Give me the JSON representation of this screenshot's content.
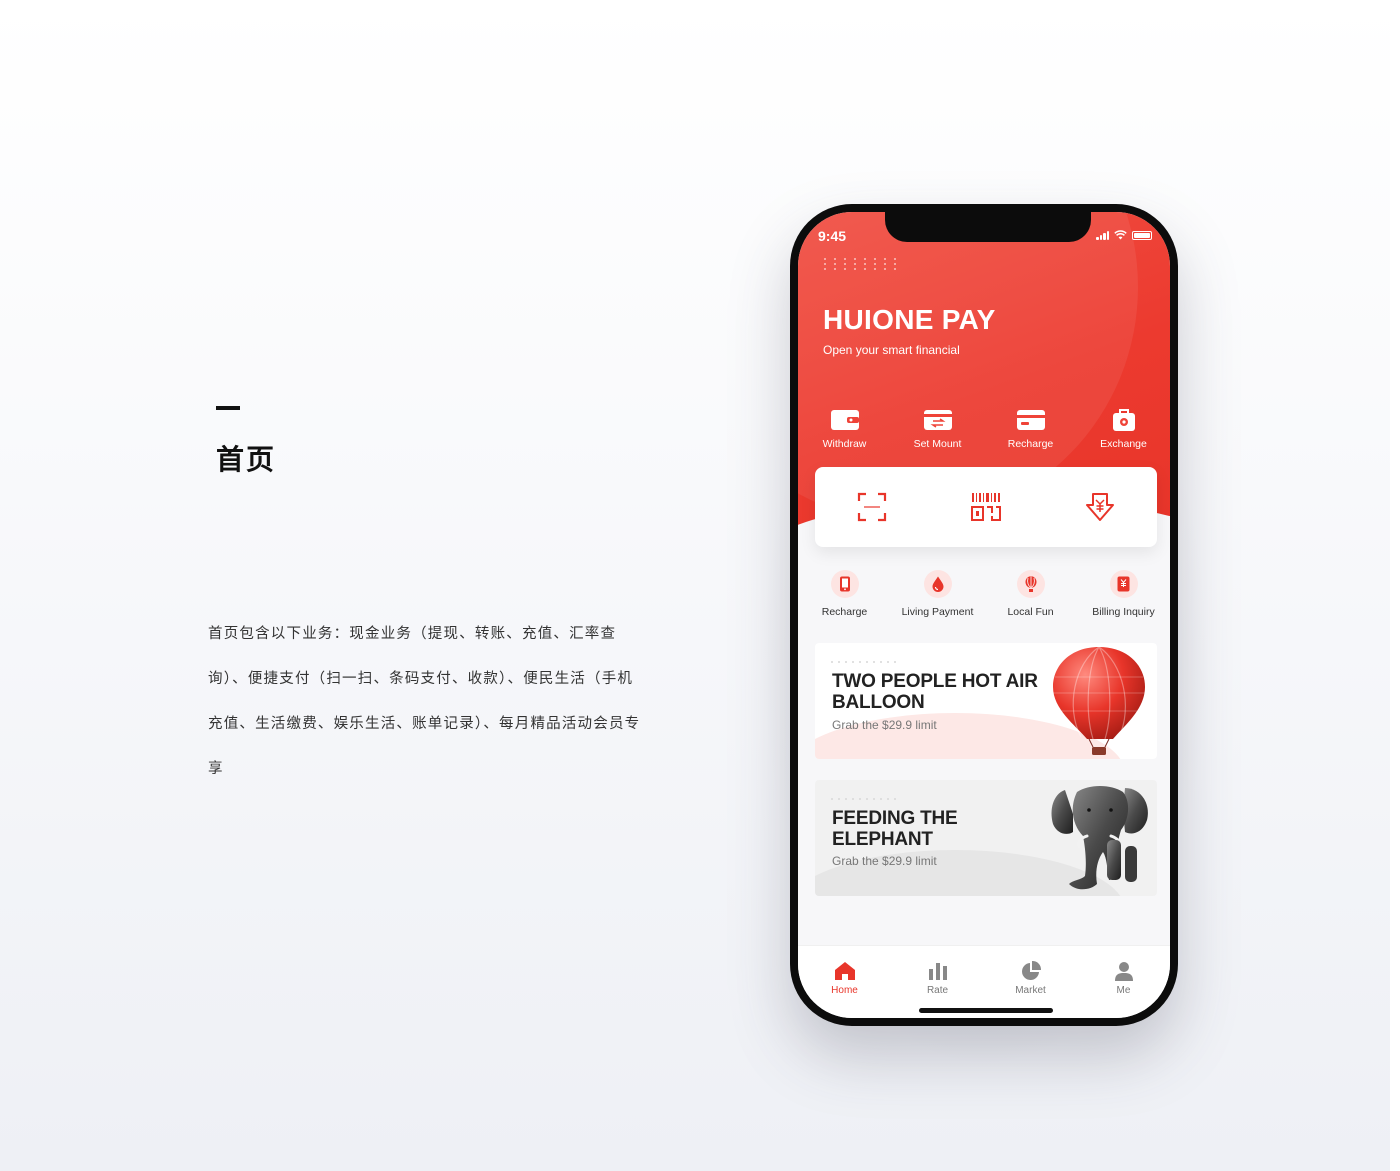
{
  "intro": {
    "title": "首页",
    "description": "首页包含以下业务：现金业务（提现、转账、充值、汇率查询）、便捷支付（扫一扫、条码支付、收款）、便民生活（手机充值、生活缴费、娱乐生活、账单记录）、每月精品活动会员专享"
  },
  "status_bar": {
    "time": "9:45"
  },
  "header": {
    "brand": "HUIONE PAY",
    "tagline": "Open your smart financial"
  },
  "quick_actions": [
    {
      "label": "Withdraw",
      "icon": "wallet-icon"
    },
    {
      "label": "Set Mount",
      "icon": "transfer-card-icon"
    },
    {
      "label": "Recharge",
      "icon": "card-icon"
    },
    {
      "label": "Exchange",
      "icon": "exchange-bag-icon"
    }
  ],
  "pay_actions": [
    {
      "icon": "scan-icon"
    },
    {
      "icon": "barcode-icon"
    },
    {
      "icon": "receive-money-icon"
    }
  ],
  "services": [
    {
      "label": "Recharge",
      "icon": "phone-icon"
    },
    {
      "label": "Living Payment",
      "icon": "drop-icon"
    },
    {
      "label": "Local Fun",
      "icon": "balloon-icon"
    },
    {
      "label": "Billing Inquiry",
      "icon": "bill-icon"
    }
  ],
  "banners": [
    {
      "title": "TWO PEOPLE HOT AIR BALLOON",
      "subtitle": "Grab the $29.9 limit",
      "image": "hot-air-balloon"
    },
    {
      "title": "FEEDING THE ELEPHANT",
      "subtitle": "Grab the $29.9 limit",
      "image": "elephant"
    }
  ],
  "tabbar": [
    {
      "label": "Home",
      "icon": "home-icon",
      "active": true
    },
    {
      "label": "Rate",
      "icon": "bar-chart-icon",
      "active": false
    },
    {
      "label": "Market",
      "icon": "pie-chart-icon",
      "active": false
    },
    {
      "label": "Me",
      "icon": "user-icon",
      "active": false
    }
  ],
  "colors": {
    "accent": "#e8352a",
    "accent_light": "#fde4e2",
    "background": "#f7f7f9"
  }
}
